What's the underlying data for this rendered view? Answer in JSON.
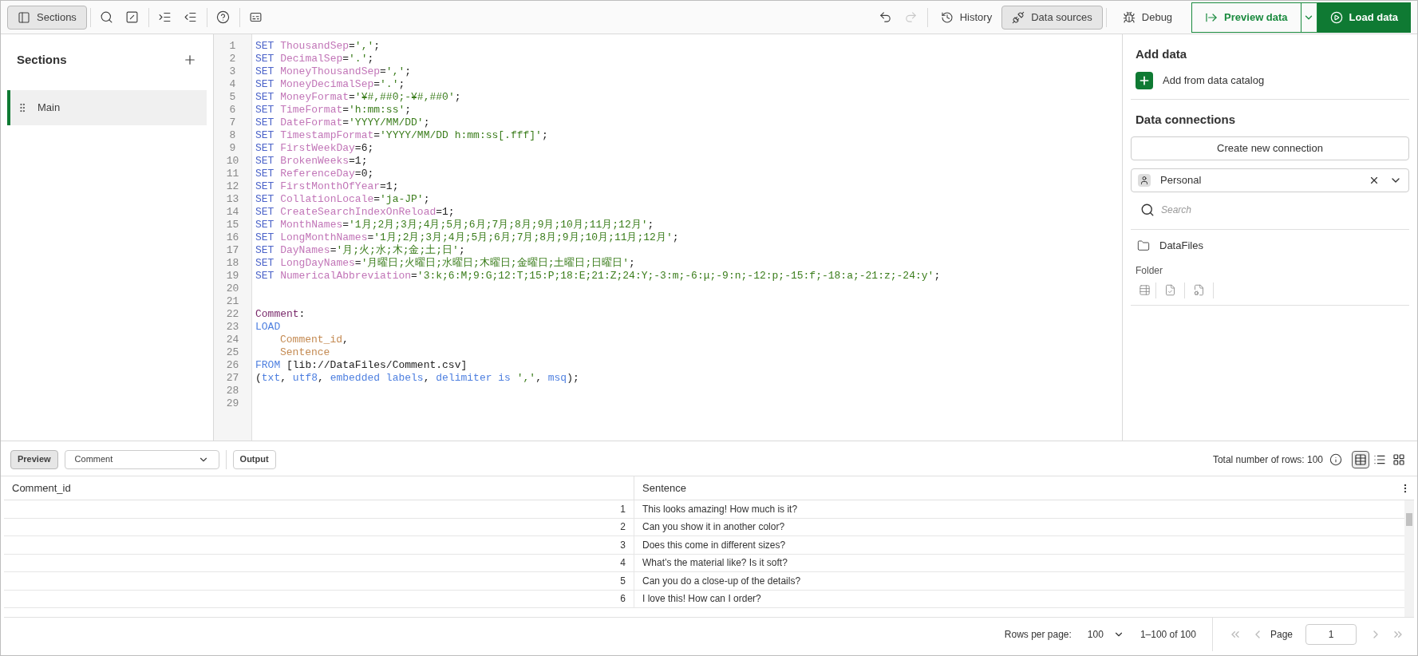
{
  "toolbar": {
    "sections_button": {
      "label": "Sections",
      "selected": true
    },
    "history_button": {
      "label": "History"
    },
    "data_sources_button": {
      "label": "Data sources",
      "selected": true
    },
    "debug_button": {
      "label": "Debug"
    },
    "preview_data_button": {
      "label": "Preview data"
    },
    "load_data_button": {
      "label": "Load data"
    }
  },
  "sidebar": {
    "title": "Sections",
    "items": [
      {
        "label": "Main",
        "selected": true
      }
    ]
  },
  "editor": {
    "lines": [
      {
        "number": "1",
        "tokens": [
          {
            "kind": "kw",
            "text": "SET "
          },
          {
            "kind": "var",
            "text": "ThousandSep"
          },
          {
            "kind": "plain",
            "text": "="
          },
          {
            "kind": "str",
            "text": "','"
          },
          {
            "kind": "plain",
            "text": ";"
          }
        ]
      },
      {
        "number": "2",
        "tokens": [
          {
            "kind": "kw",
            "text": "SET "
          },
          {
            "kind": "var",
            "text": "DecimalSep"
          },
          {
            "kind": "plain",
            "text": "="
          },
          {
            "kind": "str",
            "text": "'.'"
          },
          {
            "kind": "plain",
            "text": ";"
          }
        ]
      },
      {
        "number": "3",
        "tokens": [
          {
            "kind": "kw",
            "text": "SET "
          },
          {
            "kind": "var",
            "text": "MoneyThousandSep"
          },
          {
            "kind": "plain",
            "text": "="
          },
          {
            "kind": "str",
            "text": "','"
          },
          {
            "kind": "plain",
            "text": ";"
          }
        ]
      },
      {
        "number": "4",
        "tokens": [
          {
            "kind": "kw",
            "text": "SET "
          },
          {
            "kind": "var",
            "text": "MoneyDecimalSep"
          },
          {
            "kind": "plain",
            "text": "="
          },
          {
            "kind": "str",
            "text": "'.'"
          },
          {
            "kind": "plain",
            "text": ";"
          }
        ]
      },
      {
        "number": "5",
        "tokens": [
          {
            "kind": "kw",
            "text": "SET "
          },
          {
            "kind": "var",
            "text": "MoneyFormat"
          },
          {
            "kind": "plain",
            "text": "="
          },
          {
            "kind": "str",
            "text": "'¥#,##0;-¥#,##0'"
          },
          {
            "kind": "plain",
            "text": ";"
          }
        ]
      },
      {
        "number": "6",
        "tokens": [
          {
            "kind": "kw",
            "text": "SET "
          },
          {
            "kind": "var",
            "text": "TimeFormat"
          },
          {
            "kind": "plain",
            "text": "="
          },
          {
            "kind": "str",
            "text": "'h:mm:ss'"
          },
          {
            "kind": "plain",
            "text": ";"
          }
        ]
      },
      {
        "number": "7",
        "tokens": [
          {
            "kind": "kw",
            "text": "SET "
          },
          {
            "kind": "var",
            "text": "DateFormat"
          },
          {
            "kind": "plain",
            "text": "="
          },
          {
            "kind": "str",
            "text": "'YYYY/MM/DD'"
          },
          {
            "kind": "plain",
            "text": ";"
          }
        ]
      },
      {
        "number": "8",
        "tokens": [
          {
            "kind": "kw",
            "text": "SET "
          },
          {
            "kind": "var",
            "text": "TimestampFormat"
          },
          {
            "kind": "plain",
            "text": "="
          },
          {
            "kind": "str",
            "text": "'YYYY/MM/DD h:mm:ss[.fff]'"
          },
          {
            "kind": "plain",
            "text": ";"
          }
        ]
      },
      {
        "number": "9",
        "tokens": [
          {
            "kind": "kw",
            "text": "SET "
          },
          {
            "kind": "var",
            "text": "FirstWeekDay"
          },
          {
            "kind": "plain",
            "text": "=6;"
          }
        ]
      },
      {
        "number": "10",
        "tokens": [
          {
            "kind": "kw",
            "text": "SET "
          },
          {
            "kind": "var",
            "text": "BrokenWeeks"
          },
          {
            "kind": "plain",
            "text": "=1;"
          }
        ]
      },
      {
        "number": "11",
        "tokens": [
          {
            "kind": "kw",
            "text": "SET "
          },
          {
            "kind": "var",
            "text": "ReferenceDay"
          },
          {
            "kind": "plain",
            "text": "=0;"
          }
        ]
      },
      {
        "number": "12",
        "tokens": [
          {
            "kind": "kw",
            "text": "SET "
          },
          {
            "kind": "var",
            "text": "FirstMonthOfYear"
          },
          {
            "kind": "plain",
            "text": "=1;"
          }
        ]
      },
      {
        "number": "13",
        "tokens": [
          {
            "kind": "kw",
            "text": "SET "
          },
          {
            "kind": "var",
            "text": "CollationLocale"
          },
          {
            "kind": "plain",
            "text": "="
          },
          {
            "kind": "str",
            "text": "'ja-JP'"
          },
          {
            "kind": "plain",
            "text": ";"
          }
        ]
      },
      {
        "number": "14",
        "tokens": [
          {
            "kind": "kw",
            "text": "SET "
          },
          {
            "kind": "var",
            "text": "CreateSearchIndexOnReload"
          },
          {
            "kind": "plain",
            "text": "=1;"
          }
        ]
      },
      {
        "number": "15",
        "tokens": [
          {
            "kind": "kw",
            "text": "SET "
          },
          {
            "kind": "var",
            "text": "MonthNames"
          },
          {
            "kind": "plain",
            "text": "="
          },
          {
            "kind": "str",
            "text": "'1月;2月;3月;4月;5月;6月;7月;8月;9月;10月;11月;12月'"
          },
          {
            "kind": "plain",
            "text": ";"
          }
        ]
      },
      {
        "number": "16",
        "tokens": [
          {
            "kind": "kw",
            "text": "SET "
          },
          {
            "kind": "var",
            "text": "LongMonthNames"
          },
          {
            "kind": "plain",
            "text": "="
          },
          {
            "kind": "str",
            "text": "'1月;2月;3月;4月;5月;6月;7月;8月;9月;10月;11月;12月'"
          },
          {
            "kind": "plain",
            "text": ";"
          }
        ]
      },
      {
        "number": "17",
        "tokens": [
          {
            "kind": "kw",
            "text": "SET "
          },
          {
            "kind": "var",
            "text": "DayNames"
          },
          {
            "kind": "plain",
            "text": "="
          },
          {
            "kind": "str",
            "text": "'月;火;水;木;金;土;日'"
          },
          {
            "kind": "plain",
            "text": ";"
          }
        ]
      },
      {
        "number": "18",
        "tokens": [
          {
            "kind": "kw",
            "text": "SET "
          },
          {
            "kind": "var",
            "text": "LongDayNames"
          },
          {
            "kind": "plain",
            "text": "="
          },
          {
            "kind": "str",
            "text": "'月曜日;火曜日;水曜日;木曜日;金曜日;土曜日;日曜日'"
          },
          {
            "kind": "plain",
            "text": ";"
          }
        ]
      },
      {
        "number": "19",
        "tokens": [
          {
            "kind": "kw",
            "text": "SET "
          },
          {
            "kind": "var",
            "text": "NumericalAbbreviation"
          },
          {
            "kind": "plain",
            "text": "="
          },
          {
            "kind": "str",
            "text": "'3:k;6:M;9:G;12:T;15:P;18:E;21:Z;24:Y;-3:m;-6:μ;-9:n;-12:p;-15:f;-18:a;-21:z;-24:y'"
          },
          {
            "kind": "plain",
            "text": ";"
          }
        ]
      },
      {
        "number": "20"
      },
      {
        "number": "21"
      },
      {
        "number": "22",
        "tokens": [
          {
            "kind": "label",
            "text": "Comment"
          },
          {
            "kind": "plain",
            "text": ":"
          }
        ]
      },
      {
        "number": "23",
        "tokens": [
          {
            "kind": "fn",
            "text": "LOAD"
          }
        ],
        "children": [
          {
            "number": "24",
            "tokens": [
              {
                "kind": "field",
                "text": "Comment_id"
              },
              {
                "kind": "plain",
                "text": ","
              }
            ]
          },
          {
            "number": "25",
            "tokens": [
              {
                "kind": "field",
                "text": "Sentence"
              }
            ]
          }
        ]
      },
      {
        "number": "26",
        "tokens": [
          {
            "kind": "fn",
            "text": "FROM "
          },
          {
            "kind": "plain",
            "text": "[lib://DataFiles/Comment.csv]"
          }
        ]
      },
      {
        "number": "27",
        "tokens": [
          {
            "kind": "plain",
            "text": "("
          },
          {
            "kind": "fn",
            "text": "txt"
          },
          {
            "kind": "plain",
            "text": ", "
          },
          {
            "kind": "fn",
            "text": "utf8"
          },
          {
            "kind": "plain",
            "text": ", "
          },
          {
            "kind": "fn",
            "text": "embedded labels"
          },
          {
            "kind": "plain",
            "text": ", "
          },
          {
            "kind": "fn",
            "text": "delimiter is "
          },
          {
            "kind": "str",
            "text": "','"
          },
          {
            "kind": "plain",
            "text": ", "
          },
          {
            "kind": "fn",
            "text": "msq"
          },
          {
            "kind": "plain",
            "text": ");"
          }
        ]
      },
      {
        "number": "28"
      },
      {
        "number": "29"
      }
    ]
  },
  "data_panel": {
    "add_data_title": "Add data",
    "add_from_catalog": "Add from data catalog",
    "data_connections_title": "Data connections",
    "create_connection_button": "Create new connection",
    "space_select": {
      "value": "Personal"
    },
    "search": {
      "placeholder": "Search"
    },
    "connections": [
      {
        "name": "DataFiles",
        "type": "Folder"
      }
    ]
  },
  "preview": {
    "tabs": [
      {
        "label": "Preview",
        "selected": true
      },
      {
        "label": "Output",
        "selected": false
      }
    ],
    "table_select": {
      "value": "Comment"
    },
    "total_rows": "Total number of rows: 100",
    "view_modes": [
      {
        "kind": "table",
        "selected": true
      },
      {
        "kind": "list",
        "selected": false
      },
      {
        "kind": "grid",
        "selected": false
      }
    ],
    "table": {
      "columns": [
        "Comment_id",
        "Sentence"
      ],
      "rows": [
        {
          "comment_id": "1",
          "sentence": "This looks amazing! How much is it?"
        },
        {
          "comment_id": "2",
          "sentence": "Can you show it in another color?"
        },
        {
          "comment_id": "3",
          "sentence": "Does this come in different sizes?"
        },
        {
          "comment_id": "4",
          "sentence": "What’s the material like? Is it soft?"
        },
        {
          "comment_id": "5",
          "sentence": "Can you do a close-up of the details?"
        },
        {
          "comment_id": "6",
          "sentence": "I love this! How can I order?"
        }
      ]
    },
    "pagination": {
      "rows_per_page_label": "Rows per page:",
      "rows_per_page": "100",
      "range": "1–100 of 100",
      "page_label": "Page",
      "page": "1"
    }
  }
}
